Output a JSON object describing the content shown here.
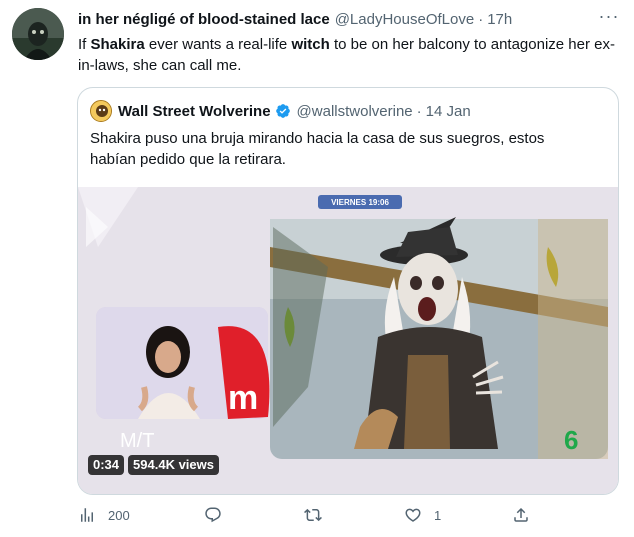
{
  "tweet": {
    "author_name": "in her négligé of blood-stained lace",
    "author_handle": "@LadyHouseOfLove",
    "separator": "·",
    "time": "17h",
    "text": {
      "p1": "If ",
      "bold1": "Shakira",
      "p2": " ever wants a real-life ",
      "bold2": "witch",
      "p3": " to be on her balcony to antagonize her ex-in-laws, she can call me."
    }
  },
  "quoted_tweet": {
    "author_name": "Wall Street Wolverine",
    "author_handle": "@wallstwolverine",
    "separator": "·",
    "date": "14 Jan",
    "text": "Shakira puso una bruja mirando hacia la casa de sus suegros, estos habían pedido que la retirara.",
    "verified_icon": "verified-badge-icon"
  },
  "video": {
    "duration": "0:34",
    "views": "594.4K views",
    "overlay_time_tag": "VIERNES 19:06",
    "overlay_logo": "M/T",
    "channel_logo": "6"
  },
  "actions": {
    "views_count": "200",
    "reply_count": "",
    "retweet_count": "",
    "like_count": "1",
    "icons": [
      "analytics-icon",
      "reply-icon",
      "retweet-icon",
      "like-icon",
      "share-icon"
    ]
  },
  "colors": {
    "text_primary": "#0f1419",
    "text_secondary": "#536471",
    "border": "#cfd9de",
    "verified": "#1d9bf0"
  }
}
